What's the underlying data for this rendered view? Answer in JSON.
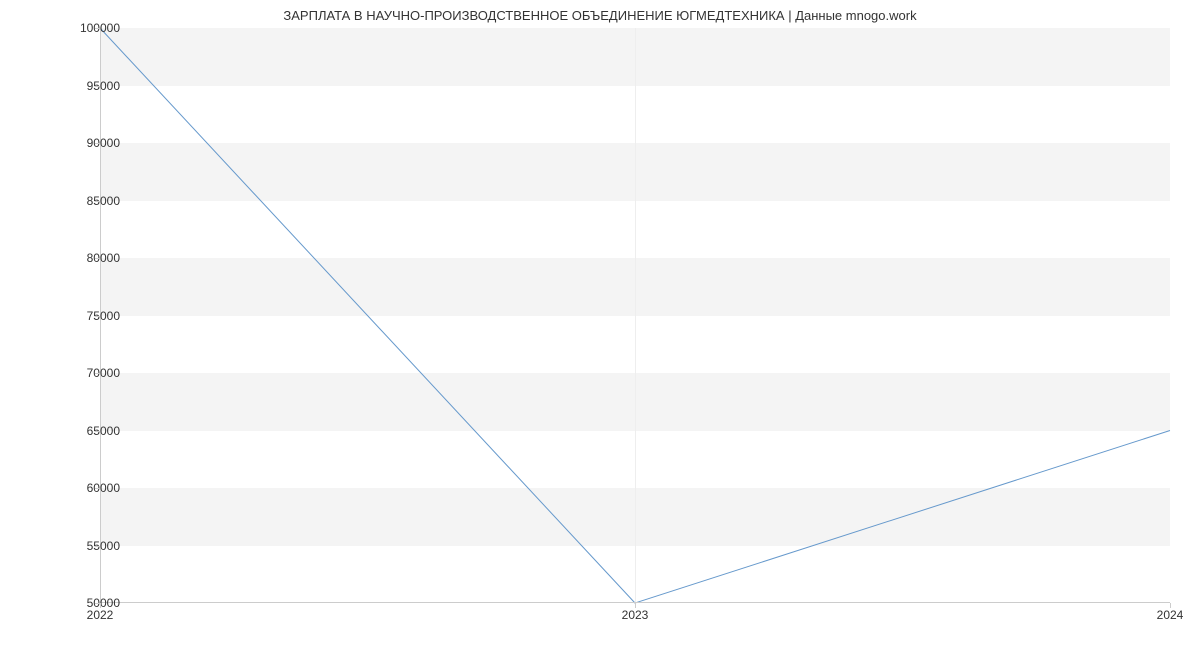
{
  "chart_data": {
    "type": "line",
    "title": "ЗАРПЛАТА В  НАУЧНО-ПРОИЗВОДСТВЕННОЕ ОБЪЕДИНЕНИЕ ЮГМЕДТЕХНИКА | Данные mnogo.work",
    "x": [
      2022,
      2023,
      2024
    ],
    "values": [
      100000,
      50000,
      65000
    ],
    "xlabel": "",
    "ylabel": "",
    "xlim": [
      2022,
      2024
    ],
    "ylim": [
      50000,
      100000
    ],
    "x_ticks": [
      2022,
      2023,
      2024
    ],
    "y_ticks": [
      50000,
      55000,
      60000,
      65000,
      70000,
      75000,
      80000,
      85000,
      90000,
      95000,
      100000
    ],
    "line_color": "#6699cc"
  }
}
